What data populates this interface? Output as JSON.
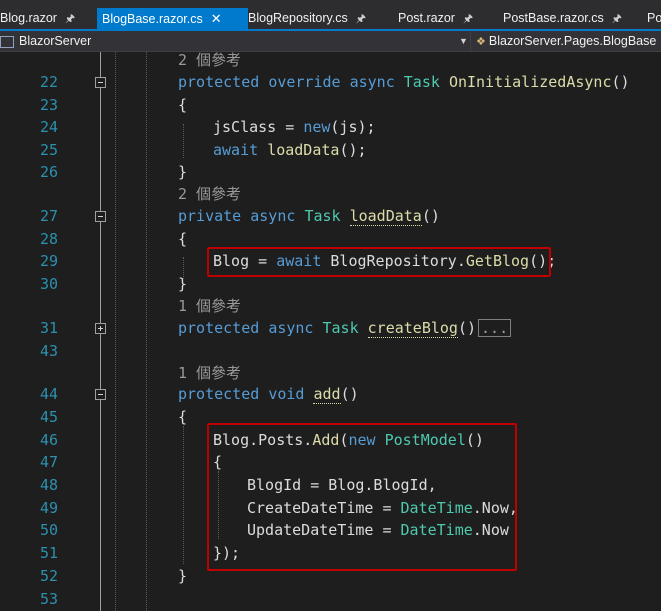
{
  "tabs": [
    {
      "label": "Blog.razor",
      "pin": "🖈",
      "active": false
    },
    {
      "label": "BlogBase.razor.cs",
      "pin": "✕",
      "active": true
    },
    {
      "label": "BlogRepository.cs",
      "pin": "🖈",
      "active": false
    },
    {
      "label": "Post.razor",
      "pin": "🖈",
      "active": false
    },
    {
      "label": "PostBase.razor.cs",
      "pin": "🖈",
      "active": false
    },
    {
      "label": "Po",
      "pin": "",
      "active": false
    }
  ],
  "navbar": {
    "project": "BlazorServer",
    "class_path": "BlazorServer.Pages.BlogBase"
  },
  "references": {
    "r1": "2 個參考",
    "r2": "2 個參考",
    "r3": "1 個參考",
    "r4": "1 個參考"
  },
  "line_numbers": [
    "22",
    "23",
    "24",
    "25",
    "26",
    "27",
    "28",
    "29",
    "30",
    "31",
    "43",
    "44",
    "45",
    "46",
    "47",
    "48",
    "49",
    "50",
    "51",
    "52",
    "53"
  ],
  "code": {
    "l22": {
      "kw1": "protected",
      "kw2": "override",
      "kw3": "async",
      "ty": "Task",
      "fn": "OnInitializedAsync",
      "rest": "()"
    },
    "l23": "{",
    "l24": {
      "a": "jsClass = ",
      "kw": "new",
      "b": "(js);"
    },
    "l25": {
      "kw": "await",
      "fn": "loadData",
      "b": "();"
    },
    "l26": "}",
    "l27": {
      "kw1": "private",
      "kw2": "async",
      "ty": "Task",
      "fn": "loadData",
      "rest": "()"
    },
    "l28": "{",
    "l29": {
      "a": "Blog = ",
      "kw": "await",
      "b": "BlogRepository.",
      "fn": "GetBlog",
      "c": "();"
    },
    "l30": "}",
    "l31": {
      "kw1": "protected",
      "kw2": "async",
      "ty": "Task",
      "fn": "createBlog",
      "rest": "()",
      "collapsed": "..."
    },
    "l44": {
      "kw1": "protected",
      "kw2": "void",
      "fn": "add",
      "rest": "()"
    },
    "l45": "{",
    "l46": {
      "a": "Blog.Posts.",
      "fn": "Add",
      "b": "(",
      "kw": "new",
      "ty": "PostModel",
      "c": "()"
    },
    "l47": "{",
    "l48": "BlogId = Blog.BlogId,",
    "l49": {
      "a": "CreateDateTime = ",
      "ty": "DateTime",
      "b": ".Now,"
    },
    "l50": {
      "a": "UpdateDateTime = ",
      "ty": "DateTime",
      "b": ".Now"
    },
    "l51": "});",
    "l52": "}"
  },
  "colors": {
    "background": "#1e1e1e",
    "keyword": "#569cd6",
    "type": "#4ec9b0",
    "method": "#dcdcaa",
    "line_number": "#2b91af",
    "highlight_box": "#c00000",
    "active_tab": "#007acc"
  }
}
